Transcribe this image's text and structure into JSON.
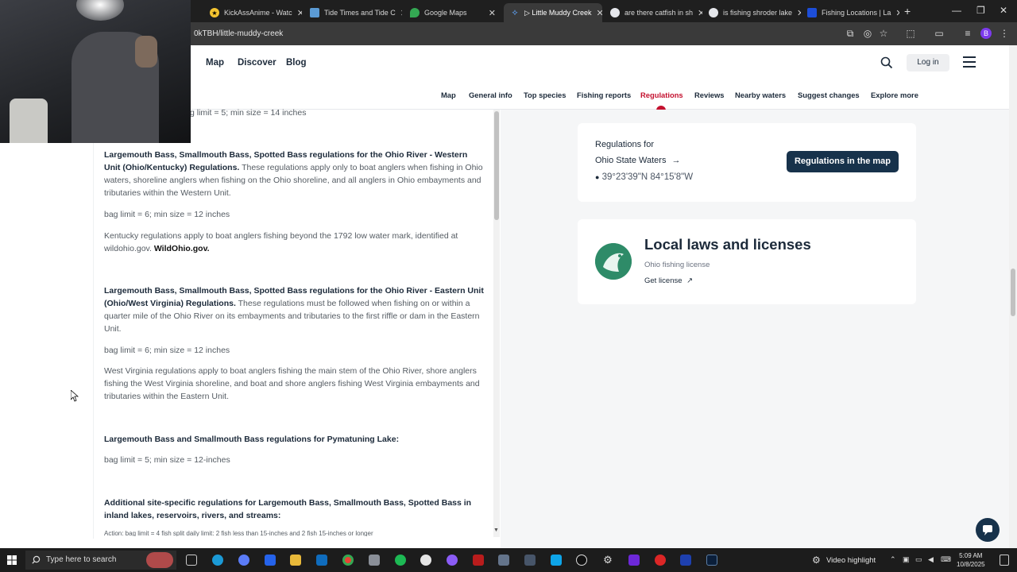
{
  "browser": {
    "tabs": [
      {
        "title": "KickAssAnime - Watc",
        "favicon_color": "#f4c430"
      },
      {
        "title": "Tide Times and Tide C",
        "favicon_color": "#5b9bd5"
      },
      {
        "title": "Google Maps",
        "favicon_color": "#34a853"
      },
      {
        "title": "▷ Little Muddy Creek",
        "favicon_color": "#3b82f6",
        "active": true
      },
      {
        "title": "are there catfish in sh",
        "favicon_color": "#e5e7eb"
      },
      {
        "title": "is fishing shroder lake",
        "favicon_color": "#e5e7eb"
      },
      {
        "title": "Fishing Locations | La",
        "favicon_color": "#1d4ed8"
      }
    ],
    "url": "0kTBH/little-muddy-creek",
    "profile_initial": "B"
  },
  "header": {
    "nav": [
      "Map",
      "Discover",
      "Blog"
    ],
    "login_label": "Log in"
  },
  "subnav": {
    "items": [
      "Map",
      "General info",
      "Top species",
      "Fishing reports",
      "Regulations",
      "Reviews",
      "Nearby waters",
      "Suggest changes",
      "Explore more"
    ],
    "active": "Regulations",
    "accent_color": "#c4112f"
  },
  "regulations": [
    {
      "type": "text",
      "text": "g limit = 5; min size = 14 inches"
    },
    {
      "type": "rule",
      "heading": "Largemouth Bass, Smallmouth Bass, Spotted Bass regulations for the Ohio River - Western Unit (Ohio/Kentucky) Regulations.",
      "body": "These regulations apply only to boat anglers when fishing in Ohio waters, shoreline anglers when fishing on the Ohio shoreline, and all anglers in Ohio embayments and tributaries within the Western Unit."
    },
    {
      "type": "text",
      "text": "bag limit = 6; min size = 12 inches"
    },
    {
      "type": "link",
      "text": "Kentucky regulations apply to boat anglers fishing beyond the 1792 low water mark, identified at wildohio.gov.",
      "link": "WildOhio.gov"
    },
    {
      "type": "rule",
      "heading": "Largemouth Bass, Smallmouth Bass, Spotted Bass regulations for the Ohio River - Eastern Unit (Ohio/West Virginia) Regulations.",
      "body": "These regulations must be followed when fishing on or within a quarter mile of the Ohio River on its embayments and tributaries to the first riffle or dam in the Eastern Unit."
    },
    {
      "type": "text",
      "text": "bag limit = 6; min size = 12 inches"
    },
    {
      "type": "text",
      "text": "West Virginia regulations apply to boat anglers fishing the main stem of the Ohio River, shore anglers fishing the West Virginia shoreline, and boat and shore anglers fishing West Virginia embayments and tributaries within the Eastern Unit."
    },
    {
      "type": "heading",
      "text": "Largemouth Bass and Smallmouth Bass regulations for Pymatuning Lake:"
    },
    {
      "type": "text",
      "text": "bag limit = 5; min size = 12-inches"
    },
    {
      "type": "heading",
      "text": "Additional site-specific regulations for Largemouth Bass, Smallmouth Bass, Spotted Bass in inland lakes, reservoirs, rivers, and streams:"
    },
    {
      "type": "text",
      "text": "Action: bag limit = 4 fish split daily limit: 2 fish less than 15-inches and 2 fish 15-inches or longer"
    }
  ],
  "reg_card": {
    "label": "Regulations for",
    "state_link": "Ohio State Waters",
    "coords": "39°23'39\"N 84°15'8\"W",
    "map_button": "Regulations in the map"
  },
  "licenses": {
    "title": "Local laws and licenses",
    "subtitle": "Ohio fishing license",
    "link": "Get license"
  },
  "taskbar": {
    "search_placeholder": "Type here to search",
    "tray_label": "Video highlight",
    "time": "5:09 AM",
    "date": "10/8/2025"
  }
}
